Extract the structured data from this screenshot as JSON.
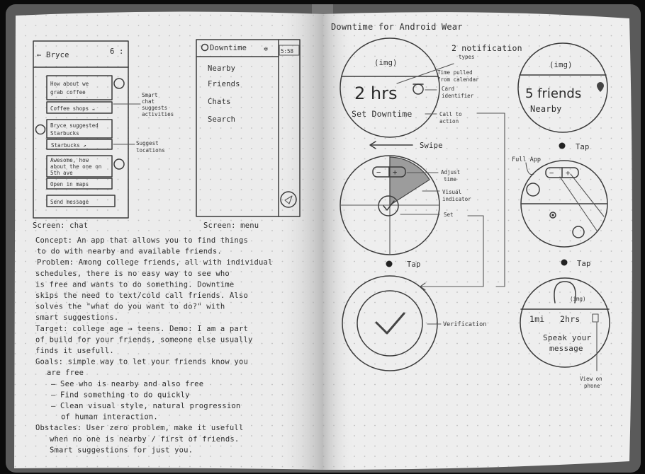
{
  "left_page": {
    "chat_screen": {
      "back": "← Bryce",
      "count": "6 :",
      "messages": [
        {
          "lines": [
            "How about we",
            "grab coffee"
          ]
        },
        {
          "lines": [
            "Bryce suggested",
            "Starbucks"
          ]
        },
        {
          "lines": [
            "Awesome, how",
            "about the one on",
            "5th ave"
          ]
        }
      ],
      "actions": [
        "Coffee shops ☕",
        "Starbucks ↗",
        "Open in maps"
      ],
      "send": "Send message",
      "notes": [
        [
          "Smart",
          "chat",
          "suggests",
          "activities"
        ],
        [
          "Suggest",
          "locations"
        ]
      ],
      "caption": "Screen: chat"
    },
    "menu_screen": {
      "title": "Downtime",
      "time": "5:58",
      "items": [
        "Nearby",
        "Friends",
        "Chats",
        "Search"
      ],
      "caption": "Screen: menu"
    },
    "notes": [
      "Concept: An app that allows you to find things",
      "to do with nearby and available friends.",
      "Problem: Among college friends, all with individual",
      "schedules, there is no easy way to see who",
      "is free and wants to do something. Downtime",
      "skips the need to text/cold call friends. Also",
      "solves the \"what do you want to do?\" with",
      "smart suggestions.",
      "Target: college age → teens. Demo: I am a part",
      "of build for your friends, someone else usually",
      "finds it usefull.",
      "Goals: simple way to let your friends know you",
      "are free",
      "– See who is nearby and also free",
      "– Find something to do quickly",
      "– Clean visual style, natural progression",
      "of human interaction.",
      "Obstacles: User zero problem, make it usefull",
      "when no one is nearby / first of friends.",
      "Smart suggestions for just you."
    ]
  },
  "right_page": {
    "title": "Downtime for Android Wear",
    "watch1": {
      "img": "(img)",
      "hours": "2 hrs",
      "cta": "Set Downtime",
      "annotations": [
        [
          "2 notification",
          "types"
        ],
        [
          "Time pulled",
          "from calendar"
        ],
        [
          "Card",
          "identifier"
        ],
        [
          "Call to",
          "action"
        ]
      ]
    },
    "swipe": "Swipe",
    "watch2": {
      "annotations": [
        [
          "Adjust",
          "time"
        ],
        [
          "Visual",
          "indicator"
        ],
        [
          "Set"
        ]
      ]
    },
    "tap_labels": [
      "Tap",
      "Tap",
      "Tap"
    ],
    "verification": "Verification",
    "watch_friends": {
      "img": "(img)",
      "count": "5 friends",
      "sub": "Nearby"
    },
    "full_app": "Full App",
    "watch_detail": {
      "img": "(img)",
      "distance": "1mi",
      "hours": "2hrs",
      "prompt": [
        "Speak your",
        "message"
      ]
    },
    "view_on_phone": [
      "View on",
      "phone"
    ]
  }
}
